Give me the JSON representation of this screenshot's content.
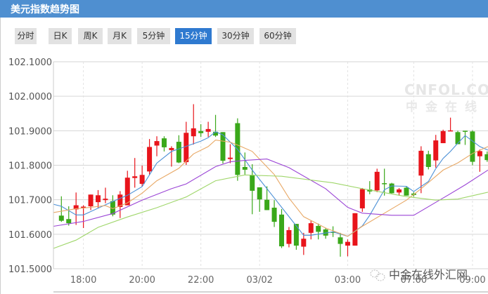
{
  "header": {
    "title": "美元指数趋势图"
  },
  "tabs": [
    {
      "label": "分时",
      "active": false
    },
    {
      "label": "日K",
      "active": false
    },
    {
      "label": "周K",
      "active": false
    },
    {
      "label": "月K",
      "active": false
    },
    {
      "label": "5分钟",
      "active": false
    },
    {
      "label": "15分钟",
      "active": true
    },
    {
      "label": "30分钟",
      "active": false
    },
    {
      "label": "60分钟",
      "active": false
    }
  ],
  "watermark": {
    "brand": "CNFOL.COM",
    "brand_cn": "中金在线",
    "wechat": "中金在线外汇网"
  },
  "colors": {
    "up": "#e8141b",
    "down": "#3aa81a",
    "ma1": "#4a8fd6",
    "ma2": "#e8a865",
    "ma3": "#9b45d6",
    "ma4": "#9fd66a",
    "active_tab": "#2f7ad0",
    "header": "#4f8fd0"
  },
  "chart_data": {
    "type": "candlestick",
    "interval": "15分钟",
    "ylim": [
      101.5,
      102.1
    ],
    "yticks": [
      "102.1000",
      "102.0000",
      "101.9000",
      "101.8000",
      "101.7000",
      "101.6000",
      "101.5000"
    ],
    "xticks": [
      {
        "label": "18:00",
        "candle": 4
      },
      {
        "label": "20:00",
        "candle": 12
      },
      {
        "label": "22:00",
        "candle": 20
      },
      {
        "label": "03/02",
        "candle": 28
      },
      {
        "label": "03:00",
        "candle": 40
      },
      {
        "label": "07:00",
        "candle": 49
      },
      {
        "label": "09:00",
        "candle": 57
      }
    ],
    "grid": true,
    "candles": [
      [
        101.654,
        101.71,
        101.636,
        101.639
      ],
      [
        101.644,
        101.681,
        101.625,
        101.632
      ],
      [
        101.672,
        101.721,
        101.627,
        101.684
      ],
      [
        101.677,
        101.684,
        101.618,
        101.68
      ],
      [
        101.681,
        101.715,
        101.67,
        101.715
      ],
      [
        101.693,
        101.728,
        101.677,
        101.713
      ],
      [
        101.699,
        101.735,
        101.69,
        101.703
      ],
      [
        101.696,
        101.713,
        101.652,
        101.657
      ],
      [
        101.679,
        101.725,
        101.647,
        101.715
      ],
      [
        101.684,
        101.784,
        101.684,
        101.764
      ],
      [
        101.763,
        101.821,
        101.735,
        101.768
      ],
      [
        101.746,
        101.799,
        101.738,
        101.772
      ],
      [
        101.782,
        101.876,
        101.772,
        101.853
      ],
      [
        101.857,
        101.884,
        101.826,
        101.87
      ],
      [
        101.878,
        101.884,
        101.84,
        101.852
      ],
      [
        101.844,
        101.855,
        101.796,
        101.85
      ],
      [
        101.868,
        101.887,
        101.806,
        101.808
      ],
      [
        101.809,
        101.926,
        101.801,
        101.894
      ],
      [
        101.884,
        101.977,
        101.86,
        101.907
      ],
      [
        101.899,
        101.919,
        101.882,
        101.893
      ],
      [
        101.897,
        101.926,
        101.882,
        101.905
      ],
      [
        101.897,
        101.946,
        101.882,
        101.886
      ],
      [
        101.896,
        101.896,
        101.805,
        101.813
      ],
      [
        101.818,
        101.861,
        101.806,
        101.822
      ],
      [
        101.922,
        101.936,
        101.755,
        101.772
      ],
      [
        101.795,
        101.837,
        101.773,
        101.787
      ],
      [
        101.772,
        101.803,
        101.658,
        101.726
      ],
      [
        101.736,
        101.736,
        101.665,
        101.701
      ],
      [
        101.7,
        101.739,
        101.67,
        101.67
      ],
      [
        101.677,
        101.699,
        101.621,
        101.636
      ],
      [
        101.657,
        101.673,
        101.56,
        101.565
      ],
      [
        101.572,
        101.621,
        101.562,
        101.612
      ],
      [
        101.63,
        101.63,
        101.555,
        101.567
      ],
      [
        101.564,
        101.604,
        101.54,
        101.587
      ],
      [
        101.604,
        101.639,
        101.585,
        101.632
      ],
      [
        101.624,
        101.631,
        101.585,
        101.607
      ],
      [
        101.614,
        101.619,
        101.587,
        101.596
      ],
      [
        101.607,
        101.623,
        101.592,
        101.604
      ],
      [
        101.591,
        101.604,
        101.535,
        101.572
      ],
      [
        101.567,
        101.585,
        101.536,
        101.578
      ],
      [
        101.567,
        101.661,
        101.567,
        101.661
      ],
      [
        101.675,
        101.734,
        101.665,
        101.731
      ],
      [
        101.73,
        101.754,
        101.716,
        101.724
      ],
      [
        101.727,
        101.79,
        101.722,
        101.781
      ],
      [
        101.748,
        101.79,
        101.712,
        101.745
      ],
      [
        101.747,
        101.749,
        101.718,
        101.719
      ],
      [
        101.721,
        101.734,
        101.712,
        101.73
      ],
      [
        101.735,
        101.739,
        101.712,
        101.712
      ],
      [
        101.718,
        101.722,
        101.709,
        101.714
      ],
      [
        101.77,
        101.855,
        101.719,
        101.842
      ],
      [
        101.832,
        101.842,
        101.788,
        101.795
      ],
      [
        101.814,
        101.888,
        101.793,
        101.872
      ],
      [
        101.864,
        101.903,
        101.864,
        101.899
      ],
      [
        101.899,
        101.938,
        101.899,
        101.901
      ],
      [
        101.896,
        101.9,
        101.861,
        101.861
      ],
      [
        101.9,
        101.9,
        101.859,
        101.897
      ],
      [
        101.898,
        101.901,
        101.8,
        101.81
      ],
      [
        101.826,
        101.846,
        101.781,
        101.841
      ],
      [
        101.832,
        101.84,
        101.81,
        101.815
      ]
    ],
    "candle_fields": [
      "open",
      "high",
      "low",
      "close"
    ],
    "ma_lines": [
      {
        "color": "#4a8fd6",
        "points": [
          [
            -0.1,
            101.687
          ],
          [
            1,
            101.681
          ],
          [
            3,
            101.656
          ],
          [
            4,
            101.656
          ],
          [
            8,
            101.695
          ],
          [
            10,
            101.713
          ],
          [
            12,
            101.738
          ],
          [
            14,
            101.806
          ],
          [
            16,
            101.84
          ],
          [
            18,
            101.855
          ],
          [
            20,
            101.87
          ],
          [
            21,
            101.88
          ],
          [
            22,
            101.897
          ],
          [
            23,
            101.888
          ],
          [
            25,
            101.846
          ],
          [
            26,
            101.816
          ],
          [
            27,
            101.786
          ],
          [
            30,
            101.705
          ],
          [
            33,
            101.624
          ],
          [
            34,
            101.597
          ],
          [
            35,
            101.597
          ],
          [
            38,
            101.607
          ],
          [
            40,
            101.594
          ],
          [
            42,
            101.624
          ],
          [
            43,
            101.655
          ],
          [
            45,
            101.729
          ],
          [
            46,
            101.74
          ],
          [
            48,
            101.739
          ],
          [
            49,
            101.724
          ],
          [
            51,
            101.753
          ],
          [
            52,
            101.79
          ],
          [
            53,
            101.82
          ],
          [
            54,
            101.84
          ],
          [
            55,
            101.864
          ],
          [
            56,
            101.886
          ],
          [
            58,
            101.854
          ],
          [
            59.1,
            101.844
          ]
        ]
      },
      {
        "color": "#e8a865",
        "points": [
          [
            -0.1,
            101.663
          ],
          [
            3,
            101.674
          ],
          [
            5,
            101.678
          ],
          [
            7,
            101.683
          ],
          [
            8,
            101.674
          ],
          [
            10,
            101.691
          ],
          [
            12,
            101.719
          ],
          [
            14,
            101.755
          ],
          [
            17,
            101.791
          ],
          [
            19,
            101.833
          ],
          [
            21,
            101.854
          ],
          [
            22,
            101.873
          ],
          [
            24,
            101.867
          ],
          [
            25.2,
            101.857
          ],
          [
            27,
            101.84
          ],
          [
            30,
            101.773
          ],
          [
            32,
            101.705
          ],
          [
            34,
            101.651
          ],
          [
            37,
            101.618
          ],
          [
            40,
            101.594
          ],
          [
            42,
            101.623
          ],
          [
            45,
            101.661
          ],
          [
            48,
            101.699
          ],
          [
            50,
            101.732
          ],
          [
            53,
            101.786
          ],
          [
            55,
            101.807
          ],
          [
            57,
            101.834
          ],
          [
            59.1,
            101.854
          ]
        ]
      },
      {
        "color": "#9b45d6",
        "points": [
          [
            -0.1,
            101.623
          ],
          [
            4,
            101.637
          ],
          [
            8,
            101.66
          ],
          [
            12,
            101.699
          ],
          [
            16,
            101.732
          ],
          [
            18,
            101.746
          ],
          [
            22,
            101.796
          ],
          [
            24,
            101.81
          ],
          [
            26,
            101.814
          ],
          [
            29,
            101.818
          ],
          [
            32,
            101.793
          ],
          [
            37,
            101.732
          ],
          [
            40,
            101.678
          ],
          [
            42,
            101.661
          ],
          [
            46,
            101.655
          ],
          [
            49,
            101.655
          ],
          [
            53,
            101.705
          ],
          [
            56,
            101.743
          ],
          [
            59.1,
            101.786
          ]
        ]
      },
      {
        "color": "#9fd66a",
        "points": [
          [
            -0.1,
            101.559
          ],
          [
            3,
            101.583
          ],
          [
            6,
            101.62
          ],
          [
            10,
            101.65
          ],
          [
            14,
            101.677
          ],
          [
            18,
            101.708
          ],
          [
            22,
            101.755
          ],
          [
            26,
            101.772
          ],
          [
            31,
            101.768
          ],
          [
            38,
            101.749
          ],
          [
            42,
            101.732
          ],
          [
            48,
            101.709
          ],
          [
            52,
            101.699
          ],
          [
            55,
            101.702
          ],
          [
            59.1,
            101.722
          ]
        ]
      }
    ]
  }
}
